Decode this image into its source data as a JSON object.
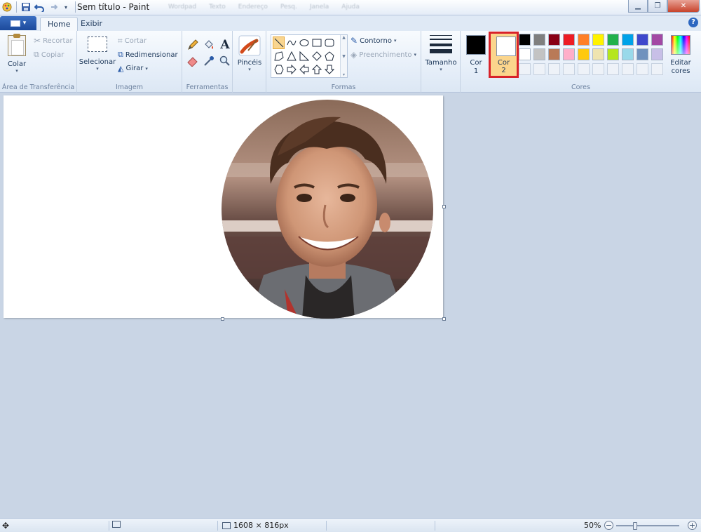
{
  "window": {
    "title": "Sem título - Paint",
    "blurred_menu": [
      "Wordpad",
      "Texto",
      "Endereço",
      "Pesq.",
      "Janela",
      "Ajuda"
    ]
  },
  "tabs": [
    {
      "label": "Home",
      "active": true
    },
    {
      "label": "Exibir",
      "active": false
    }
  ],
  "clipboard": {
    "paste": "Colar",
    "cut": "Recortar",
    "copy": "Copiar",
    "group_label": "Área de Transferência"
  },
  "image": {
    "select": "Selecionar",
    "crop": "Cortar",
    "resize": "Redimensionar",
    "rotate": "Girar",
    "group_label": "Imagem"
  },
  "tools": {
    "group_label": "Ferramentas",
    "items": [
      "pencil-icon",
      "fill-icon",
      "text-icon",
      "eraser-icon",
      "color-picker-icon",
      "magnifier-icon"
    ]
  },
  "brushes": {
    "label": "Pincéis"
  },
  "shapes": {
    "outline": "Contorno",
    "fill": "Preenchimento",
    "group_label": "Formas"
  },
  "size": {
    "label": "Tamanho"
  },
  "colors": {
    "color1_label": "Cor\n1",
    "color1_line1": "Cor",
    "color1_line2": "1",
    "color2_line1": "Cor",
    "color2_line2": "2",
    "color1_value": "#000000",
    "color2_value": "#ffffff",
    "edit_line1": "Editar",
    "edit_line2": "cores",
    "group_label": "Cores",
    "palette": [
      "#000000",
      "#7f7f7f",
      "#880015",
      "#ed1c24",
      "#ff7f27",
      "#fff200",
      "#22b14c",
      "#00a2e8",
      "#3f48cc",
      "#a349a4",
      "#ffffff",
      "#c3c3c3",
      "#b97a57",
      "#ffaec9",
      "#ffc90e",
      "#efe4b0",
      "#b5e61d",
      "#99d9ea",
      "#7092be",
      "#c8bfe7"
    ],
    "empty_slots": 10
  },
  "status": {
    "dimensions": "1608 × 816px",
    "zoom": "50%"
  }
}
